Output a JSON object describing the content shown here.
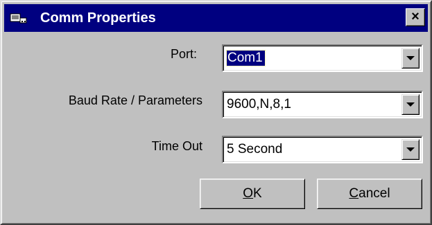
{
  "window": {
    "title": "Comm Properties",
    "close_glyph": "×",
    "icon": "comm-app-icon"
  },
  "fields": [
    {
      "label": "Port:",
      "value": "Com1",
      "selected": true
    },
    {
      "label": "Baud Rate / Parameters",
      "value": "9600,N,8,1",
      "selected": false
    },
    {
      "label": "Time Out",
      "value": "5 Second",
      "selected": false
    }
  ],
  "buttons": {
    "ok": {
      "mnemonic": "O",
      "rest": "K"
    },
    "cancel": {
      "mnemonic": "C",
      "rest": "ancel"
    }
  },
  "colors": {
    "titlebar": "#000080",
    "face": "#c0c0c0",
    "selection": "#000080"
  }
}
